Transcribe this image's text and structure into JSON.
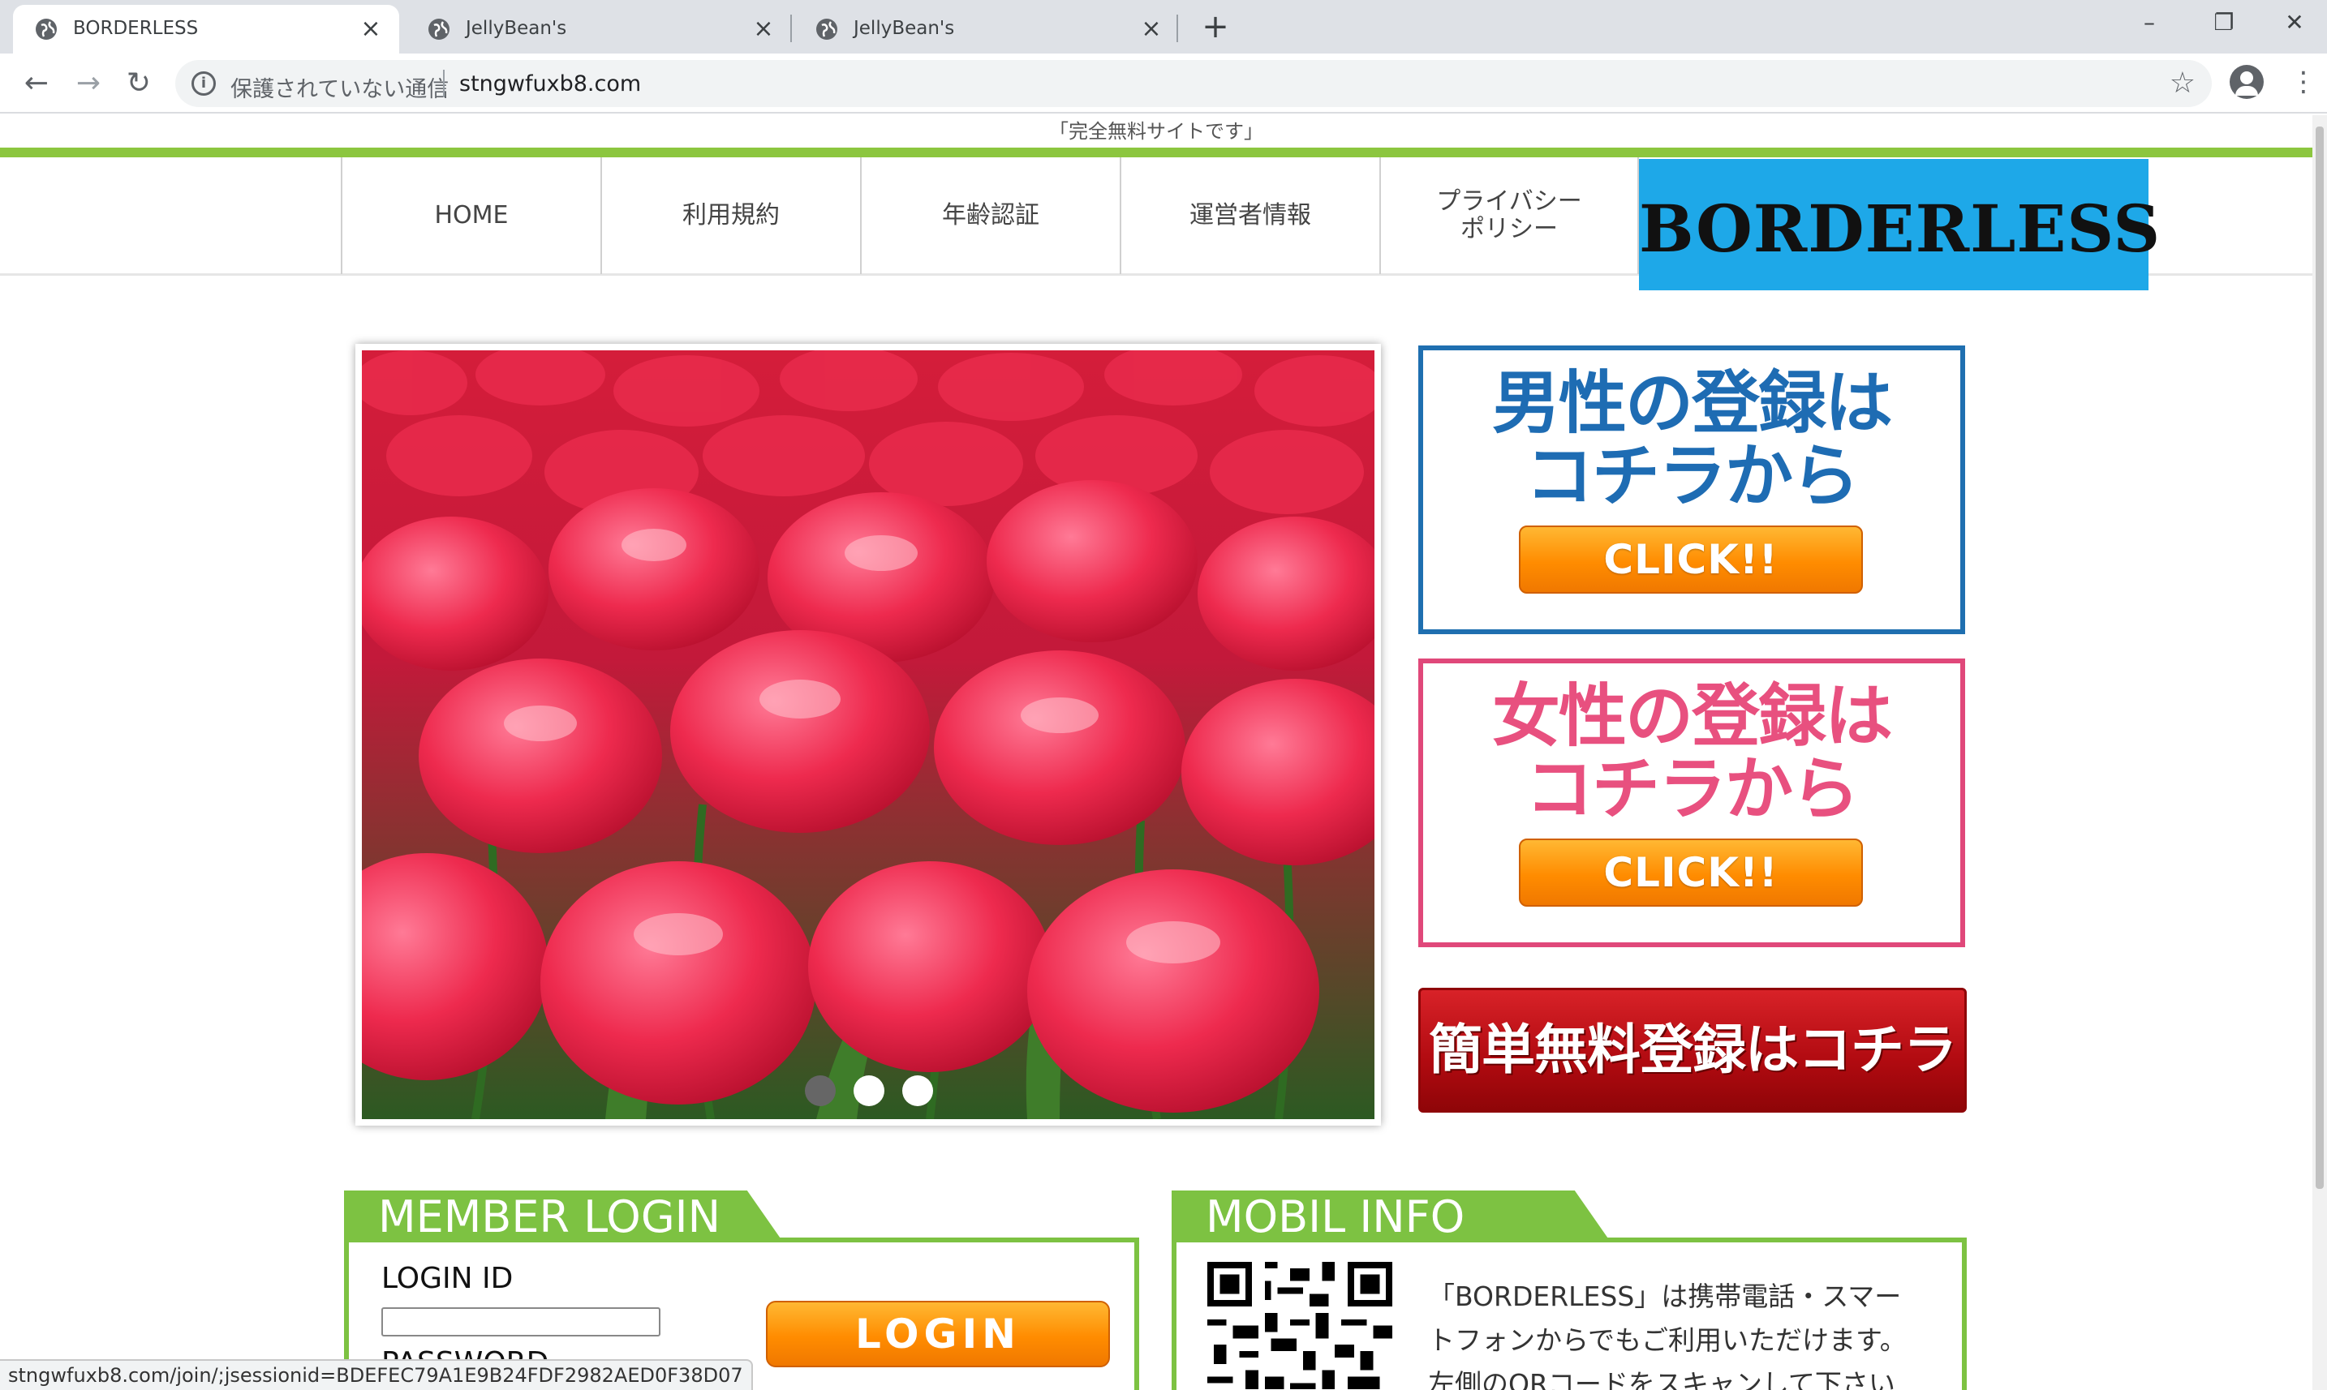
{
  "browser": {
    "tabs": [
      {
        "title": "BORDERLESS",
        "active": true
      },
      {
        "title": "JellyBean's",
        "active": false
      },
      {
        "title": "JellyBean's",
        "active": false
      }
    ],
    "new_tab": "+",
    "window_controls": {
      "minimize": "–",
      "restore": "❐",
      "close": "✕"
    },
    "nav": {
      "back": "←",
      "forward": "→",
      "reload": "↻"
    },
    "security_label": "保護されていない通信",
    "url": "stngwfuxb8.com",
    "bookmark_icon": "star-icon",
    "status_url": "stngwfuxb8.com/join/;jsessionid=BDEFEC79A1E9B24FDF2982AED0F38D07"
  },
  "site": {
    "tagline": "「完全無料サイトです」",
    "nav": [
      {
        "label": "HOME"
      },
      {
        "label": "利用規約"
      },
      {
        "label": "年齢認証"
      },
      {
        "label": "運営者情報"
      },
      {
        "label": "プライバシー\nポリシー"
      }
    ],
    "logo": "BORDERLESS",
    "slider": {
      "dots": 3,
      "active_dot": 1
    },
    "men_register": {
      "title_line1": "男性の登録は",
      "title_line2": "コチラから",
      "button": "CLICK!!"
    },
    "women_register": {
      "title_line1": "女性の登録は",
      "title_line2": "コチラから",
      "button": "CLICK!!"
    },
    "free_register": "簡単無料登録はコチラ",
    "login": {
      "heading": "MEMBER LOGIN",
      "id_label": "LOGIN ID",
      "password_label": "PASSWORD",
      "button": "LOGIN"
    },
    "mobile": {
      "heading": "MOBIL INFO",
      "text_line1": "「BORDERLESS」は携帯電話・スマー",
      "text_line2": "トフォンからでもご利用いただけます。",
      "text_line3": "左側のQRコードをスキャンして下さい"
    }
  },
  "colors": {
    "accent_green": "#8cc63f",
    "logo_blue": "#1ea8e8",
    "men_blue": "#1e6cb3",
    "women_pink": "#e8507f",
    "button_orange": "#ff8c00",
    "free_red": "#c0141a"
  }
}
